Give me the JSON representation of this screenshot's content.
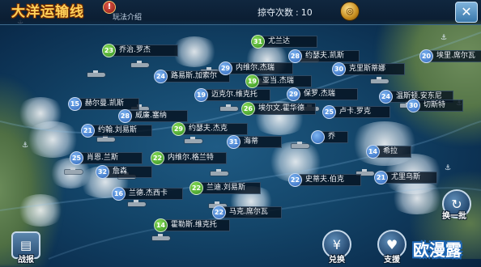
{
  "header": {
    "title": "大洋运输线",
    "help_label": "玩法介绍",
    "rob_label": "掠夺次数",
    "rob_count": "10"
  },
  "ships": [
    {
      "level": "23",
      "name": "乔治.罗杰"
    },
    {
      "level": "31",
      "name": "尤兰达"
    },
    {
      "level": "28",
      "name": "约瑟夫.凯斯"
    },
    {
      "level": "20",
      "name": "埃里.席尔瓦"
    },
    {
      "level": "29",
      "name": "内维尔.杰瑞"
    },
    {
      "level": "24",
      "name": "路易斯.加索尔"
    },
    {
      "level": "19",
      "name": "亚当.杰瑞"
    },
    {
      "level": "30",
      "name": "克里斯蒂娜"
    },
    {
      "level": "19",
      "name": "迈克尔.维克托"
    },
    {
      "level": "29",
      "name": "保罗.杰瑞"
    },
    {
      "level": "24",
      "name": "温斯顿.安东尼"
    },
    {
      "level": "15",
      "name": "赫尔曼.凯斯"
    },
    {
      "level": "26",
      "name": "埃尔文.霍华德"
    },
    {
      "level": "25",
      "name": "卢卡.罗克"
    },
    {
      "level": "30",
      "name": "切斯特"
    },
    {
      "level": "28",
      "name": "威廉.塞纳"
    },
    {
      "level": "21",
      "name": "约翰.刘易斯"
    },
    {
      "level": "29",
      "name": "约瑟夫.杰克"
    },
    {
      "level": "31",
      "name": "海蒂"
    },
    {
      "level": "",
      "name": "乔"
    },
    {
      "level": "25",
      "name": "肖恩.兰斯"
    },
    {
      "level": "22",
      "name": "内维尔.格兰特"
    },
    {
      "level": "14",
      "name": "希拉"
    },
    {
      "level": "32",
      "name": "詹森"
    },
    {
      "level": "22",
      "name": "史蒂夫.伯克"
    },
    {
      "level": "21",
      "name": "尤里乌斯"
    },
    {
      "level": "16",
      "name": "兰德.杰西卡"
    },
    {
      "level": "22",
      "name": "兰迪.刘易斯"
    },
    {
      "level": "22",
      "name": "马克.席尔瓦"
    },
    {
      "level": "14",
      "name": "霍勒斯.维克托"
    }
  ],
  "buttons": {
    "report": "战报",
    "exchange": "兑换",
    "support": "支援",
    "refresh": "换一批"
  },
  "watermark": "欧漫露",
  "colors": {
    "title": "#ffd25a",
    "ocean": "#134569"
  }
}
